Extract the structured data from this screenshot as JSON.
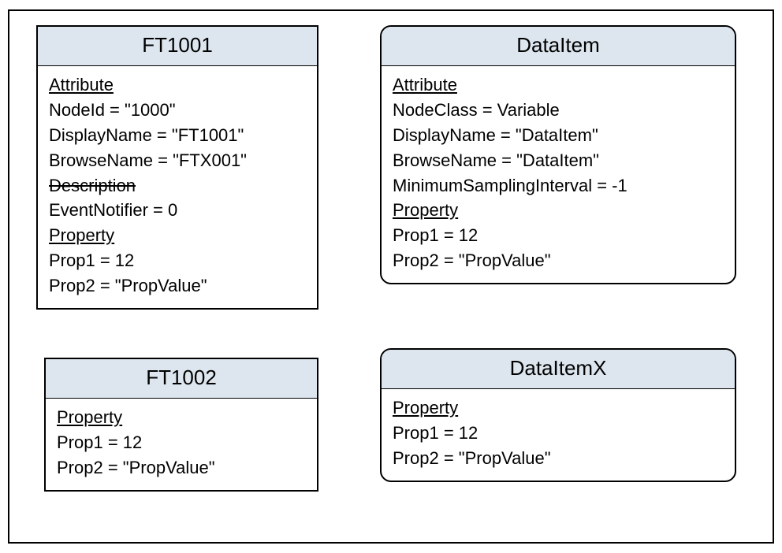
{
  "nodes": {
    "ft1001": {
      "title": "FT1001",
      "sections": {
        "attribute_heading": "Attribute",
        "attr_nodeid": "NodeId = \"1000\"",
        "attr_displayname": "DisplayName = \"FT1001\"",
        "attr_browsename": "BrowseName = \"FTX001\"",
        "attr_description": "Description",
        "attr_eventnotifier": "EventNotifier = 0",
        "property_heading": "Property",
        "prop1": "Prop1 = 12",
        "prop2": "Prop2 = \"PropValue\""
      }
    },
    "dataitem": {
      "title": "DataItem",
      "sections": {
        "attribute_heading": "Attribute",
        "attr_nodeclass": "NodeClass = Variable",
        "attr_displayname": "DisplayName = \"DataItem\"",
        "attr_browsename": "BrowseName = \"DataItem\"",
        "attr_msi": "MinimumSamplingInterval = -1",
        "property_heading": "Property",
        "prop1": "Prop1 = 12",
        "prop2": "Prop2 = \"PropValue\""
      }
    },
    "ft1002": {
      "title": "FT1002",
      "sections": {
        "property_heading": "Property",
        "prop1": "Prop1 = 12",
        "prop2": "Prop2 = \"PropValue\""
      }
    },
    "dataitemx": {
      "title": "DataItemX",
      "sections": {
        "property_heading": "Property",
        "prop1": "Prop1 = 12",
        "prop2": "Prop2 = \"PropValue\""
      }
    }
  }
}
